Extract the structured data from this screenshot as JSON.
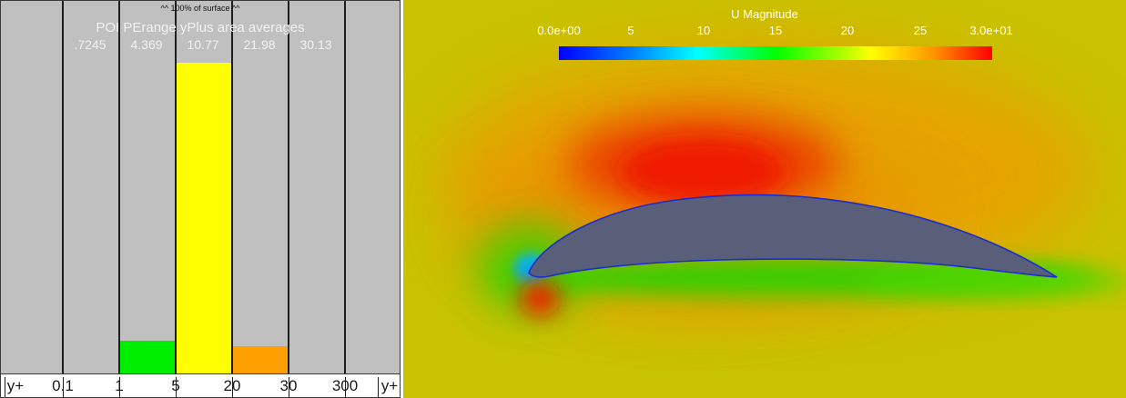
{
  "histogram": {
    "percent_label": "^^ 100% of surface ^^",
    "title": "POI PErange yPlus area averages",
    "averages": [
      ".7245",
      "4.369",
      "10.77",
      "21.98",
      "30.13"
    ],
    "x_labels": [
      "y+",
      "0.1",
      "1",
      "5",
      "20",
      "30",
      "300",
      "y+"
    ],
    "bars": [
      {
        "range": "1-5",
        "fraction_of_plot_height": 0.09,
        "color": "#00ee00"
      },
      {
        "range": "5-20",
        "fraction_of_plot_height": 0.84,
        "color": "#ffff00"
      },
      {
        "range": "20-30",
        "fraction_of_plot_height": 0.075,
        "color": "#ff9f00"
      }
    ],
    "background": "#c0c0c0"
  },
  "contour": {
    "colorbar_title": "U Magnitude",
    "colorbar_labels": [
      "0.0e+00",
      "5",
      "10",
      "15",
      "20",
      "25",
      "3.0e+01"
    ],
    "colorbar_range": [
      0,
      30
    ]
  }
}
